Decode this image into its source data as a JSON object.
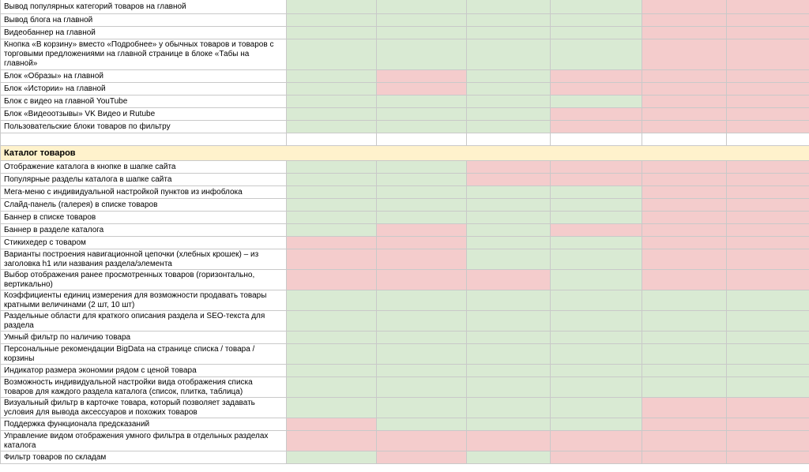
{
  "colors": {
    "green": "#d9ead3",
    "red": "#f4cccc",
    "section": "#fff2cc",
    "grid": "#c9c9c9"
  },
  "rows": [
    {
      "type": "item",
      "label": "Вывод популярных категорий товаров на главной",
      "h": 18,
      "cells": [
        "g",
        "g",
        "g",
        "g",
        "r",
        "r"
      ]
    },
    {
      "type": "item",
      "label": "Вывод блога на главной",
      "h": 16,
      "cells": [
        "g",
        "g",
        "g",
        "g",
        "r",
        "r"
      ]
    },
    {
      "type": "item",
      "label": "Видеобаннер на главной",
      "h": 16,
      "cells": [
        "g",
        "g",
        "g",
        "g",
        "r",
        "r"
      ]
    },
    {
      "type": "item",
      "label": "Кнопка «В корзину» вместо «Подробнее» у обычных товаров и товаров с торговыми предложениями на главной странице в блоке «Табы на главной»",
      "h": 39,
      "cells": [
        "g",
        "g",
        "g",
        "g",
        "r",
        "r"
      ]
    },
    {
      "type": "item",
      "label": "Блок «Образы» на главной",
      "h": 16,
      "cells": [
        "g",
        "r",
        "g",
        "r",
        "r",
        "r"
      ]
    },
    {
      "type": "item",
      "label": "Блок «Истории» на главной",
      "h": 16,
      "cells": [
        "g",
        "r",
        "g",
        "r",
        "r",
        "r"
      ]
    },
    {
      "type": "item",
      "label": "Блок с видео на главной YouTube",
      "h": 16,
      "cells": [
        "g",
        "g",
        "g",
        "g",
        "r",
        "r"
      ]
    },
    {
      "type": "item",
      "label": "Блок «Видеоотзывы» VK Видео и Rutube",
      "h": 16,
      "cells": [
        "g",
        "g",
        "g",
        "r",
        "r",
        "r"
      ]
    },
    {
      "type": "item",
      "label": "Пользовательские блоки товаров по фильтру",
      "h": 16,
      "cells": [
        "g",
        "g",
        "g",
        "r",
        "r",
        "r"
      ]
    },
    {
      "type": "blank",
      "h": 16,
      "cells": [
        "w",
        "w",
        "w",
        "w",
        "w",
        "w"
      ]
    },
    {
      "type": "section",
      "label": "Каталог товаров",
      "h": 19
    },
    {
      "type": "item",
      "label": "Отображение каталога в кнопке в шапке сайта",
      "h": 16,
      "cells": [
        "g",
        "g",
        "r",
        "r",
        "r",
        "r"
      ]
    },
    {
      "type": "item",
      "label": "Популярные разделы каталога в шапке сайта",
      "h": 16,
      "cells": [
        "g",
        "g",
        "r",
        "r",
        "r",
        "r"
      ]
    },
    {
      "type": "item",
      "label": "Мега-меню с индивидуальной настройкой пунктов из инфоблока",
      "h": 16,
      "cells": [
        "g",
        "g",
        "g",
        "g",
        "r",
        "r"
      ]
    },
    {
      "type": "item",
      "label": "Слайд-панель (галерея) в списке товаров",
      "h": 16,
      "cells": [
        "g",
        "g",
        "g",
        "g",
        "r",
        "r"
      ]
    },
    {
      "type": "item",
      "label": "Баннер в списке товаров",
      "h": 16,
      "cells": [
        "g",
        "g",
        "g",
        "g",
        "r",
        "r"
      ]
    },
    {
      "type": "item",
      "label": "Баннер в разделе каталога",
      "h": 16,
      "cells": [
        "g",
        "r",
        "g",
        "r",
        "r",
        "r"
      ]
    },
    {
      "type": "item",
      "label": "Стикихедер с товаром",
      "h": 16,
      "cells": [
        "r",
        "r",
        "g",
        "g",
        "r",
        "r"
      ]
    },
    {
      "type": "item",
      "label": "Варианты построения навигационной цепочки (хлебных крошек) – из заголовка h1 или названия раздела/элемента",
      "h": 26,
      "cells": [
        "r",
        "r",
        "g",
        "g",
        "r",
        "r"
      ]
    },
    {
      "type": "item",
      "label": "Выбор отображения ранее просмотренных товаров (горизонтально, вертикально)",
      "h": 26,
      "cells": [
        "r",
        "r",
        "r",
        "g",
        "r",
        "r"
      ]
    },
    {
      "type": "item",
      "label": "Коэффициенты единиц измерения для возможности продавать товары кратными величинами (2 шт, 10 шт)",
      "h": 26,
      "cells": [
        "g",
        "g",
        "g",
        "g",
        "g",
        "g"
      ]
    },
    {
      "type": "item",
      "label": "Раздельные области для краткого описания раздела и SEO-текста для раздела",
      "h": 26,
      "cells": [
        "g",
        "g",
        "g",
        "g",
        "g",
        "g"
      ]
    },
    {
      "type": "item",
      "label": "Умный фильтр по наличию товара",
      "h": 16,
      "cells": [
        "g",
        "g",
        "g",
        "g",
        "g",
        "g"
      ]
    },
    {
      "type": "item",
      "label": "Персональные рекомендации BigData на странице списка / товара / корзины",
      "h": 26,
      "cells": [
        "g",
        "g",
        "g",
        "g",
        "g",
        "g"
      ]
    },
    {
      "type": "item",
      "label": "Индикатор размера экономии рядом с ценой товара",
      "h": 16,
      "cells": [
        "g",
        "g",
        "g",
        "g",
        "g",
        "g"
      ]
    },
    {
      "type": "item",
      "label": "Возможность индивидуальной настройки вида отображения списка товаров для каждого раздела каталога (список, плитка, таблица)",
      "h": 26,
      "cells": [
        "g",
        "g",
        "g",
        "g",
        "g",
        "g"
      ]
    },
    {
      "type": "item",
      "label": "Визуальный фильтр в карточке товара, который позволяет задавать условия для вывода аксессуаров и похожих товаров",
      "h": 26,
      "cells": [
        "g",
        "g",
        "g",
        "g",
        "r",
        "r"
      ]
    },
    {
      "type": "item",
      "label": "Поддержка функционала предсказаний",
      "h": 16,
      "cells": [
        "r",
        "g",
        "g",
        "g",
        "r",
        "r"
      ]
    },
    {
      "type": "item",
      "label": "Управление видом отображения умного фильтра в отдельных разделах каталога",
      "h": 26,
      "cells": [
        "r",
        "r",
        "r",
        "r",
        "r",
        "r"
      ]
    },
    {
      "type": "item",
      "label": "Фильтр товаров по складам",
      "h": 16,
      "cells": [
        "g",
        "r",
        "g",
        "r",
        "r",
        "r"
      ]
    }
  ]
}
